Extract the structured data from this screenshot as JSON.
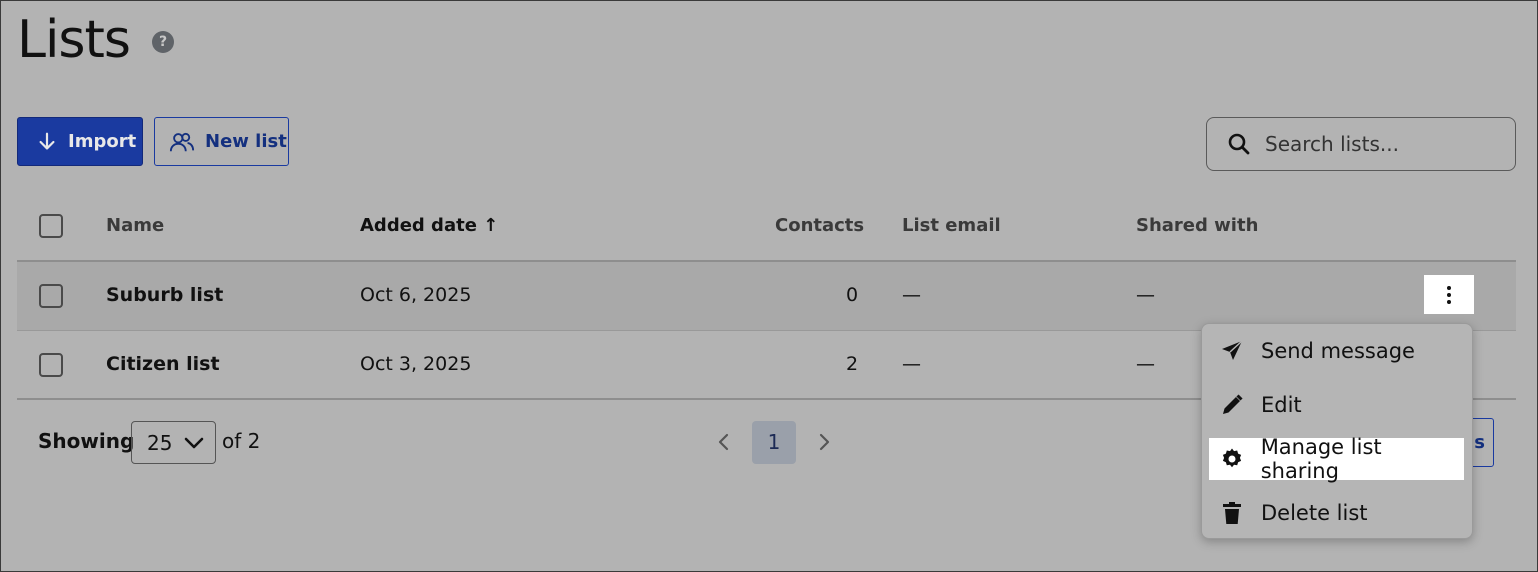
{
  "page": {
    "title": "Lists",
    "help_icon": "question-circle-icon"
  },
  "toolbar": {
    "import_label": "Import",
    "new_list_label": "New list",
    "search_placeholder": "Search lists..."
  },
  "table": {
    "headers": {
      "name": "Name",
      "added_date": "Added date",
      "contacts": "Contacts",
      "list_email": "List email",
      "shared_with": "Shared with"
    },
    "sort_indicator": "↑",
    "rows": [
      {
        "name": "Suburb list",
        "added_date": "Oct 6, 2025",
        "contacts": "0",
        "list_email": "—",
        "shared_with": "—"
      },
      {
        "name": "Citizen list",
        "added_date": "Oct 3, 2025",
        "contacts": "2",
        "list_email": "—",
        "shared_with": "—"
      }
    ]
  },
  "pagination": {
    "showing_label": "Showing",
    "page_size": "25",
    "of_total": "of 2",
    "current_page": "1"
  },
  "partial_button_label": "s",
  "row_menu": {
    "items": [
      {
        "label": "Send message",
        "icon": "paper-plane-icon"
      },
      {
        "label": "Edit",
        "icon": "pencil-icon"
      },
      {
        "label": "Manage list sharing",
        "icon": "gear-icon"
      },
      {
        "label": "Delete list",
        "icon": "trash-icon"
      }
    ]
  },
  "colors": {
    "primary": "#1a3aa0",
    "overlay_bg": "#b3b3b3"
  }
}
